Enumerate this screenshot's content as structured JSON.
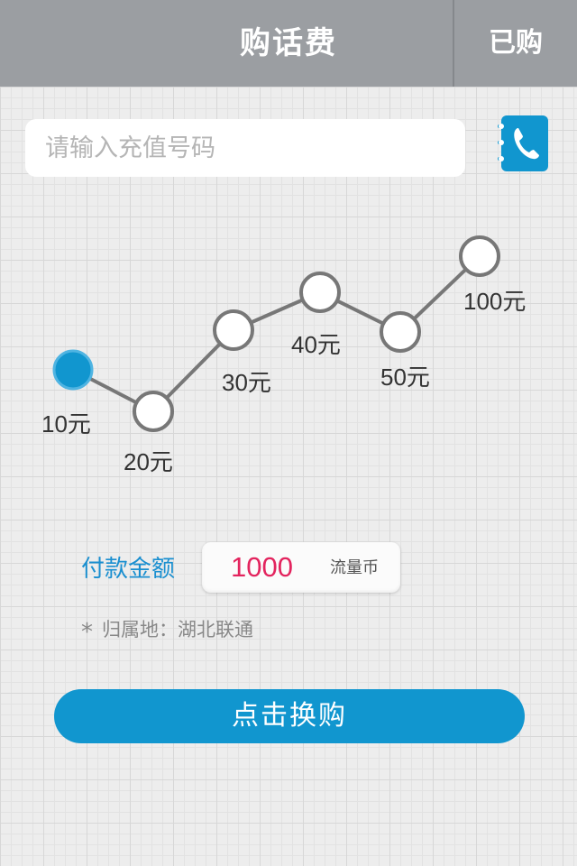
{
  "header": {
    "title": "购话费",
    "bought_label": "已购"
  },
  "phone": {
    "placeholder": "请输入充值号码",
    "value": "",
    "contacts_icon": "phone-book-icon"
  },
  "denominations": {
    "selected_index": 0,
    "items": [
      {
        "label": "10元"
      },
      {
        "label": "20元"
      },
      {
        "label": "30元"
      },
      {
        "label": "40元"
      },
      {
        "label": "50元"
      },
      {
        "label": "100元"
      }
    ]
  },
  "payment": {
    "label": "付款金额",
    "amount": "1000",
    "unit": "流量币"
  },
  "note": {
    "star": "*",
    "text": "归属地：湖北联通"
  },
  "action": {
    "button_label": "点击换购"
  },
  "colors": {
    "accent": "#1196cf",
    "amount": "#e3245e",
    "header_bg": "#9b9ea2"
  }
}
